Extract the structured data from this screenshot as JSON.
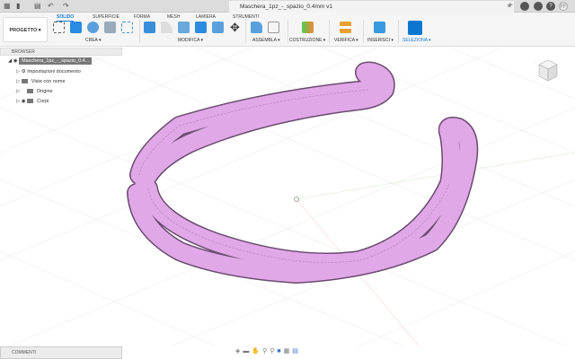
{
  "window": {
    "doc_title": "Maschera_1pz_-_spazio_0.4mm v1",
    "close": "×",
    "new_tab": "+",
    "user_initials": "FF"
  },
  "toolbar": {
    "project_label": "PROGETTO ▾",
    "tabs": [
      "SOLIDO",
      "SUPERFICIE",
      "FORMA",
      "MESH",
      "LAMIERA",
      "STRUMENTI"
    ],
    "groups": [
      "CREA ▾",
      "MODIFICA ▾",
      "ASSEMBLA ▾",
      "COSTRUZIONE ▾",
      "VERIFICA ▾",
      "INSERISCI ▾",
      "SELEZIONA ▾"
    ]
  },
  "browser": {
    "title": "BROWSER",
    "root": "Maschera_1pz_-_spazio_0.4...",
    "items": [
      "Impostazioni documento",
      "Viste con nome",
      "Origine",
      "Corpi"
    ]
  },
  "comments": {
    "title": "COMMENTI"
  },
  "colors": {
    "accent": "#1a7bd0",
    "body": "#e0a8e6",
    "outline": "#6a4a70"
  }
}
